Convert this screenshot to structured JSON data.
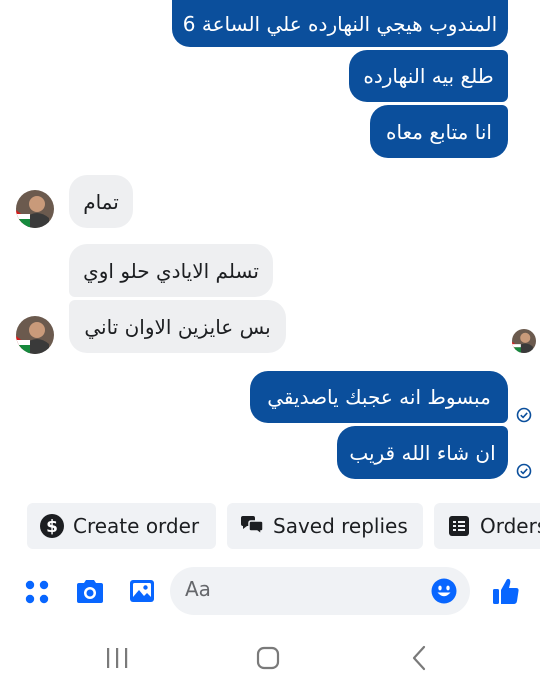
{
  "messages": [
    {
      "text": "المندوب هيجي النهارده علي الساعة 6",
      "direction": "outgoing"
    },
    {
      "text": "طلع بيه النهارده",
      "direction": "outgoing"
    },
    {
      "text": "انا متابع معاه",
      "direction": "outgoing"
    },
    {
      "text": "تمام",
      "direction": "incoming"
    },
    {
      "text": "تسلم الايادي حلو اوي",
      "direction": "incoming"
    },
    {
      "text": "بس عايزين الاوان تاني",
      "direction": "incoming"
    },
    {
      "text": "مبسوط انه عجبك ياصديقي",
      "direction": "outgoing"
    },
    {
      "text": "ان شاء الله قريب",
      "direction": "outgoing"
    }
  ],
  "quick_actions": [
    {
      "label": "Create order",
      "icon": "dollar-icon"
    },
    {
      "label": "Saved replies",
      "icon": "chat-bubbles-icon"
    },
    {
      "label": "Orders",
      "icon": "list-icon"
    }
  ],
  "composer": {
    "placeholder": "Aa",
    "icons": [
      "apps-icon",
      "camera-icon",
      "gallery-icon",
      "emoji-icon",
      "thumbs-up-icon"
    ]
  },
  "nav_bar": [
    "recent-apps-icon",
    "home-icon",
    "back-icon"
  ],
  "colors": {
    "outgoing_bubble": "#0b4f9c",
    "incoming_bubble": "#eeeff1",
    "accent": "#0866ff",
    "chip_bg": "#f0f2f5"
  }
}
